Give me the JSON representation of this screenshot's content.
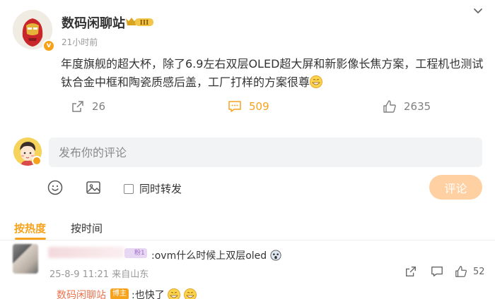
{
  "post": {
    "author": "数码闲聊站",
    "vip_level": "III",
    "time": "21小时前",
    "text": "年度旗舰的超大杯，除了6.9左右双层OLED超大屏和新影像长焦方案，工程机也测试钛合金中框和陶瓷质感后盖，工厂打样的方案很尊",
    "actions": {
      "share_count": "26",
      "comment_count": "509",
      "like_count": "2635"
    }
  },
  "composer": {
    "placeholder": "发布你的评论",
    "repost_label": "同时转发",
    "submit_label": "评论"
  },
  "sort_tabs": {
    "hot": "按热度",
    "time": "按时间"
  },
  "comment": {
    "badge": "粉1",
    "text": ":ovm什么时候上双层oled",
    "meta": "25-8-9 11:21 来自山东",
    "like_count": "52",
    "reply": {
      "author": "数码闲聊站",
      "badge": "博主",
      "text": ":也快了"
    }
  },
  "colors": {
    "accent": "#f7a21b",
    "link_orange": "#eb7350",
    "submit_disabled": "#ffd0a2"
  }
}
